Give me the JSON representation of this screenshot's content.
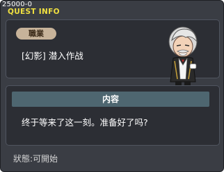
{
  "window": {
    "quest_id": "25000-0",
    "title": "QUEST INFO"
  },
  "quest": {
    "job_label": "職業",
    "name": "[幻影] 潜入作战"
  },
  "npc": {
    "icon": "old-butler-character-icon"
  },
  "content": {
    "header": "内容",
    "text": "终于等来了这一刻。准备好了吗?"
  },
  "status": {
    "text": "狀態:可開始"
  },
  "colors": {
    "window_bg": "#3a3d44",
    "panel_bg": "#2c2e34",
    "title": "#f0e040",
    "badge_bg": "#c7b39a",
    "header_bg": "#4e6670"
  }
}
